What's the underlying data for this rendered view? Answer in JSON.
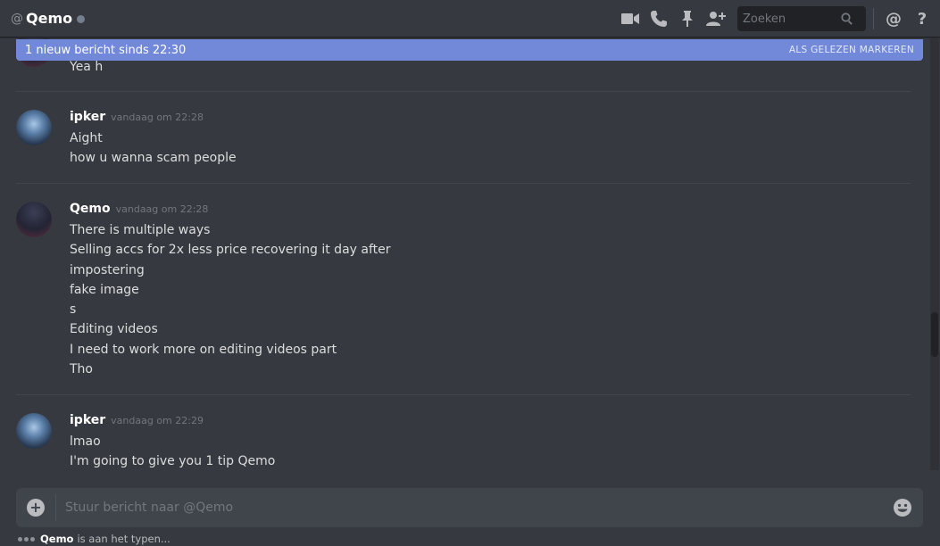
{
  "header": {
    "at": "@",
    "title": "Qemo",
    "search_placeholder": "Zoeken",
    "icons": [
      "video-camera-icon",
      "phone-icon",
      "pin-icon",
      "add-friend-icon",
      "search-icon",
      "mention-icon",
      "help-icon"
    ],
    "help": "?",
    "mention": "@"
  },
  "new_messages_bar": {
    "text": "1 nieuw bericht sinds 22:30",
    "mark_read": "ALS GELEZEN MARKEREN"
  },
  "messages": [
    {
      "author": "",
      "time": "",
      "lines": [
        "Yea h"
      ]
    },
    {
      "author": "ipker",
      "time": "vandaag om 22:28",
      "lines": [
        "Aight",
        "how u wanna scam people"
      ]
    },
    {
      "author": "Qemo",
      "time": "vandaag om 22:28",
      "lines": [
        "There is multiple ways",
        "Selling accs for 2x less price recovering it day after",
        "impostering",
        "fake image",
        "s",
        "Editing videos",
        "I need to work more on editing videos part",
        "Tho"
      ]
    },
    {
      "author": "ipker",
      "time": "vandaag om 22:29",
      "lines": [
        "lmao",
        "I'm going to give you 1 tip Qemo"
      ]
    }
  ],
  "composer": {
    "placeholder": "Stuur bericht naar @Qemo",
    "plus": "+"
  },
  "typing": {
    "user": "Qemo",
    "text": "is aan het typen..."
  },
  "colors": {
    "background": "#36393f",
    "accent": "#7289da",
    "composer": "#40444b",
    "muted": "#72767d"
  }
}
